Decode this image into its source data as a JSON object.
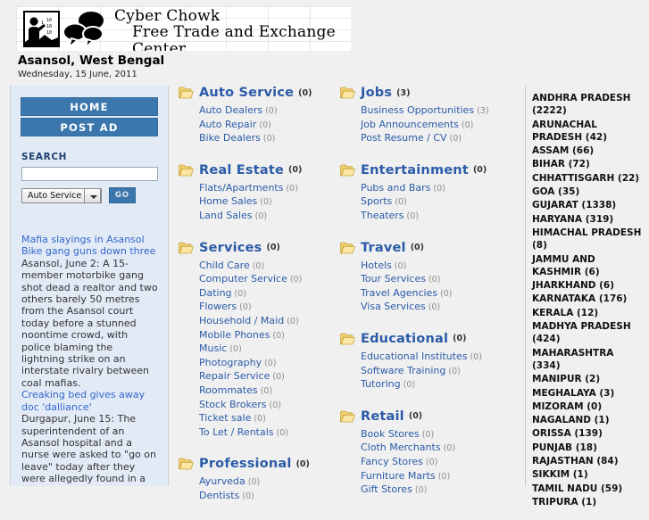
{
  "header": {
    "brand_line1": "Cyber Chowk",
    "brand_line2": "Free Trade and Exchange Center",
    "city": "Asansol, West Bengal",
    "date": "Wednesday, 15 June, 2011",
    "logo_icon": "person-binary-speech-bubbles-logo"
  },
  "sidebar": {
    "home_label": "HOME",
    "post_ad_label": "POST AD",
    "search_label": "SEARCH",
    "search_value": "",
    "search_placeholder": "",
    "category_select_value": "Auto Service",
    "go_label": "GO",
    "news": [
      {
        "headline": "Mafia slayings in Asansol Bike gang guns down three",
        "body": "Asansol, June 2: A 15-member motorbike gang shot dead a realtor and two others barely 50 metres from the Asansol court today before a stunned noontime crowd, with police blaming the lightning strike on an interstate rivalry between coal mafias."
      },
      {
        "headline": "Creaking bed gives away doc 'dalliance'",
        "body": "Durgapur, June 15: The superintendent of an Asansol hospital and a nurse were asked to \"go on leave\" today after they were allegedly found in a"
      }
    ]
  },
  "columns": [
    {
      "categories": [
        {
          "title": "Auto Service",
          "count": "(0)",
          "items": [
            {
              "name": "Auto Dealers",
              "count": "(0)"
            },
            {
              "name": "Auto Repair",
              "count": "(0)"
            },
            {
              "name": "Bike Dealers",
              "count": "(0)"
            }
          ]
        },
        {
          "title": "Real Estate",
          "count": "(0)",
          "items": [
            {
              "name": "Flats/Apartments",
              "count": "(0)"
            },
            {
              "name": "Home Sales",
              "count": "(0)"
            },
            {
              "name": "Land Sales",
              "count": "(0)"
            }
          ]
        },
        {
          "title": "Services",
          "count": "(0)",
          "items": [
            {
              "name": "Child Care",
              "count": "(0)"
            },
            {
              "name": "Computer Service",
              "count": "(0)"
            },
            {
              "name": "Dating",
              "count": "(0)"
            },
            {
              "name": "Flowers",
              "count": "(0)"
            },
            {
              "name": "Household / Maid",
              "count": "(0)"
            },
            {
              "name": "Mobile Phones",
              "count": "(0)"
            },
            {
              "name": "Music",
              "count": "(0)"
            },
            {
              "name": "Photography",
              "count": "(0)"
            },
            {
              "name": "Repair Service",
              "count": "(0)"
            },
            {
              "name": "Roommates",
              "count": "(0)"
            },
            {
              "name": "Stock Brokers",
              "count": "(0)"
            },
            {
              "name": "Ticket sale",
              "count": "(0)"
            },
            {
              "name": "To Let / Rentals",
              "count": "(0)"
            }
          ]
        },
        {
          "title": "Professional",
          "count": "(0)",
          "items": [
            {
              "name": "Ayurveda",
              "count": "(0)"
            },
            {
              "name": "Dentists",
              "count": "(0)"
            }
          ]
        }
      ]
    },
    {
      "categories": [
        {
          "title": "Jobs",
          "count": "(3)",
          "items": [
            {
              "name": "Business Opportunities",
              "count": "(3)"
            },
            {
              "name": "Job Announcements",
              "count": "(0)"
            },
            {
              "name": "Post Resume / CV",
              "count": "(0)"
            }
          ]
        },
        {
          "title": "Entertainment",
          "count": "(0)",
          "items": [
            {
              "name": "Pubs and Bars",
              "count": "(0)"
            },
            {
              "name": "Sports",
              "count": "(0)"
            },
            {
              "name": "Theaters",
              "count": "(0)"
            }
          ]
        },
        {
          "title": "Travel",
          "count": "(0)",
          "items": [
            {
              "name": "Hotels",
              "count": "(0)"
            },
            {
              "name": "Tour Services",
              "count": "(0)"
            },
            {
              "name": "Travel Agencies",
              "count": "(0)"
            },
            {
              "name": "Visa Services",
              "count": "(0)"
            }
          ]
        },
        {
          "title": "Educational",
          "count": "(0)",
          "items": [
            {
              "name": "Educational Institutes",
              "count": "(0)"
            },
            {
              "name": "Software Training",
              "count": "(0)"
            },
            {
              "name": "Tutoring",
              "count": "(0)"
            }
          ]
        },
        {
          "title": "Retail",
          "count": "(0)",
          "items": [
            {
              "name": "Book Stores",
              "count": "(0)"
            },
            {
              "name": "Cloth Merchants",
              "count": "(0)"
            },
            {
              "name": "Fancy Stores",
              "count": "(0)"
            },
            {
              "name": "Furniture Marts",
              "count": "(0)"
            },
            {
              "name": "Gift Stores",
              "count": "(0)"
            }
          ]
        }
      ]
    }
  ],
  "states": [
    "ANDHRA PRADESH (2222)",
    "ARUNACHAL PRADESH (42)",
    "ASSAM (66)",
    "BIHAR (72)",
    "CHHATTISGARH (22)",
    "GOA (35)",
    "GUJARAT (1338)",
    "HARYANA (319)",
    "HIMACHAL PRADESH (8)",
    "JAMMU AND KASHMIR (6)",
    "JHARKHAND (6)",
    "KARNATAKA (176)",
    "KERALA (12)",
    "MADHYA PRADESH (424)",
    "MAHARASHTRA (334)",
    "MANIPUR (2)",
    "MEGHALAYA (3)",
    "MIZORAM (0)",
    "NAGALAND (1)",
    "ORISSA (139)",
    "PUNJAB (18)",
    "RAJASTHAN (84)",
    "SIKKIM (1)",
    "TAMIL NADU (59)",
    "TRIPURA (1)"
  ],
  "colors": {
    "accent_blue": "#3b77ad",
    "link_blue": "#2b5ba8",
    "sidebar_bg": "#e2eaf6",
    "page_bg": "#f0f0f0",
    "folder_yellow": "#f5d97a"
  }
}
